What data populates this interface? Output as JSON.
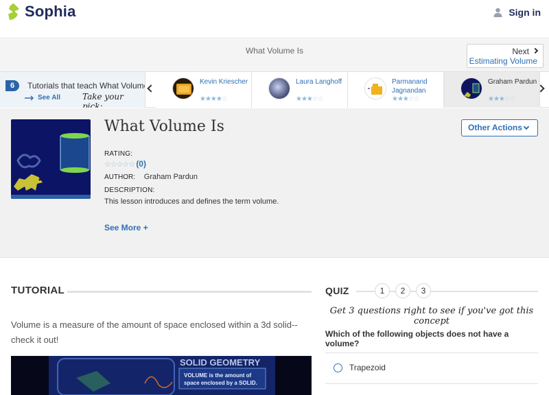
{
  "header": {
    "logo_text": "Sophia",
    "signin_label": "Sign in"
  },
  "title_band": {
    "title": "What Volume Is",
    "next_label": "Next",
    "next_sub": "Estimating Volume"
  },
  "tutorials_strip": {
    "count": "6",
    "label": "Tutorials that teach What Volume Is",
    "see_all": "See All",
    "pick_label": "Take your pick:",
    "cards": [
      {
        "name": "Kevin Kriescher",
        "rating": 4
      },
      {
        "name": "Laura Langhoff",
        "rating": 3
      },
      {
        "name": "Parmanand Jagnandan",
        "rating": 3
      },
      {
        "name": "Graham Pardun",
        "rating": 3,
        "active": true
      }
    ]
  },
  "lesson": {
    "title": "What Volume Is",
    "other_actions": "Other Actions",
    "rating_label": "RATING:",
    "rating_count": "(0)",
    "author_label": "AUTHOR:",
    "author_name": "Graham Pardun",
    "description_label": "DESCRIPTION:",
    "description": "This lesson introduces and defines the term volume.",
    "see_more": "See More +"
  },
  "tutorial": {
    "heading": "TUTORIAL",
    "text": "Volume is a measure of the amount of space enclosed within a 3d solid--check it out!",
    "video_title": "SOLID GEOMETRY",
    "video_caption_1": "VOLUME is the amount of",
    "video_caption_2": "space enclosed by a SOLID."
  },
  "quiz": {
    "heading": "QUIZ",
    "numbers": [
      "1",
      "2",
      "3"
    ],
    "hint": "Get 3 questions right to see if you've got this concept",
    "question": "Which of the following objects does not have a volume?",
    "options": [
      "Trapezoid"
    ]
  },
  "colors": {
    "brand_navy": "#1f2a5c",
    "logo_green": "#a6cf38",
    "link_blue": "#2f6fb5"
  }
}
